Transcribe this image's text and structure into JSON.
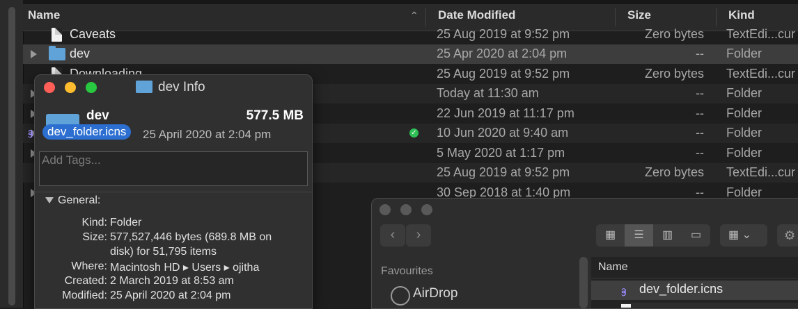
{
  "columns": {
    "name": "Name",
    "date_modified": "Date Modified",
    "size": "Size",
    "kind": "Kind"
  },
  "rows": [
    {
      "name": "Caveats",
      "date": "25 Aug 2019 at 9:52 pm",
      "size": "Zero bytes",
      "kind": "TextEdi...cur",
      "icon": "document-icon",
      "expandable": false
    },
    {
      "name": "dev",
      "date": "25 Apr 2020 at 2:04 pm",
      "size": "--",
      "kind": "Folder",
      "icon": "folder-icon",
      "expandable": true
    },
    {
      "name": "Downloading",
      "date": "25 Aug 2019 at 9:52 pm",
      "size": "Zero bytes",
      "kind": "TextEdi...cur",
      "icon": "document-icon",
      "expandable": false
    },
    {
      "name": "",
      "date": "Today at 11:30 am",
      "size": "--",
      "kind": "Folder",
      "icon": "folder-icon",
      "expandable": true
    },
    {
      "name": "",
      "date": "22 Jun 2019 at 11:17 pm",
      "size": "--",
      "kind": "Folder",
      "icon": "folder-icon",
      "expandable": true
    },
    {
      "name": "",
      "date": "10 Jun 2020 at 9:40 am",
      "size": "--",
      "kind": "Folder",
      "icon": "folder-icon",
      "expandable": true,
      "synced": true
    },
    {
      "name": "",
      "date": "5 May 2020 at 1:17 pm",
      "size": "--",
      "kind": "Folder",
      "icon": "folder-icon",
      "expandable": true
    },
    {
      "name": "",
      "date": "25 Aug 2019 at 9:52 pm",
      "size": "Zero bytes",
      "kind": "TextEdi...cur",
      "icon": "document-icon",
      "expandable": false
    },
    {
      "name": "",
      "date": "30 Sep 2018 at 1:40 pm",
      "size": "--",
      "kind": "Folder",
      "icon": "folder-icon",
      "expandable": true
    }
  ],
  "info_window": {
    "title": "dev Info",
    "name": "dev",
    "size": "577.5 MB",
    "modified_short": "25 April 2020 at 2:04 pm",
    "tags_placeholder": "Add Tags...",
    "section": "General:",
    "details": [
      {
        "label": "Kind:",
        "value": "Folder"
      },
      {
        "label": "Size:",
        "value": "577,527,446 bytes (689.8 MB on"
      },
      {
        "label": "",
        "value": "disk) for 51,795 items"
      },
      {
        "label": "Where:",
        "value": "Macintosh HD ▸ Users ▸ ojitha"
      },
      {
        "label": "Created:",
        "value": "2 March 2019 at 8:53 am"
      },
      {
        "label": "Modified:",
        "value": "25 April 2020 at 2:04 pm"
      }
    ]
  },
  "drag_pill": {
    "label": "dev_folder.icns",
    "icon": "icns-file-icon"
  },
  "second_finder": {
    "sidebar_section": "Favourites",
    "sidebar_item": "AirDrop",
    "column_header": "Name",
    "selected_file": "dev_folder.icns",
    "view_icons": [
      "icon-view-icon",
      "list-view-icon",
      "column-view-icon",
      "gallery-view-icon"
    ],
    "group_icon": "group-by-icon",
    "action_icon": "gear-icon"
  },
  "colors": {
    "folder": "#5fa3d8",
    "selection_blue": "#2c6fd1",
    "close": "#ff5f57",
    "minimize": "#febc2e",
    "zoom": "#28c840",
    "synced": "#2fbf55"
  }
}
